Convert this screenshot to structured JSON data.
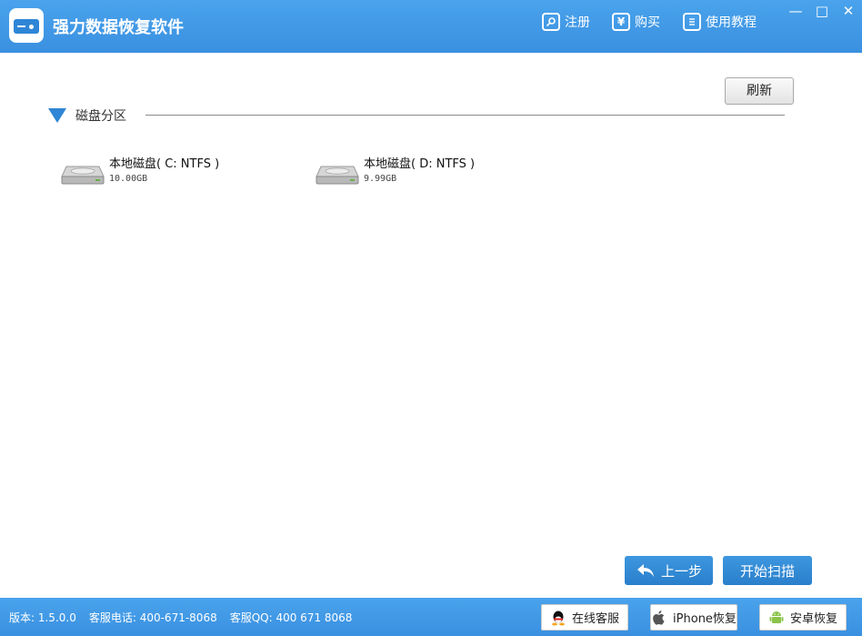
{
  "app": {
    "title": "强力数据恢复软件"
  },
  "topnav": {
    "register": "注册",
    "buy": "购买",
    "tutorial": "使用教程",
    "buy_glyph": "¥"
  },
  "window_controls": {
    "minimize": "—",
    "maximize": "□",
    "close": "✕"
  },
  "toolbar": {
    "refresh_label": "刷新"
  },
  "section": {
    "title": "磁盘分区"
  },
  "drives": [
    {
      "name": "本地磁盘( C: NTFS )",
      "size": "10.00GB"
    },
    {
      "name": "本地磁盘( D: NTFS )",
      "size": "9.99GB"
    }
  ],
  "actions": {
    "back_label": "上一步",
    "start_scan_label": "开始扫描"
  },
  "statusbar": {
    "version": "版本: 1.5.0.0",
    "phone": "客服电话: 400-671-8068",
    "qq": "客服QQ: 400 671 8068"
  },
  "footer_buttons": {
    "online_service": "在线客服",
    "iphone_recovery": "iPhone恢复",
    "android_recovery": "安卓恢复"
  },
  "colors": {
    "accent": "#3a90e0",
    "button_blue": "#2a7fcb"
  },
  "icons": [
    "disk-logo-icon",
    "key-icon",
    "yen-icon",
    "book-icon",
    "hard-drive-icon",
    "back-arrow-icon",
    "qq-icon",
    "apple-icon",
    "android-icon"
  ]
}
